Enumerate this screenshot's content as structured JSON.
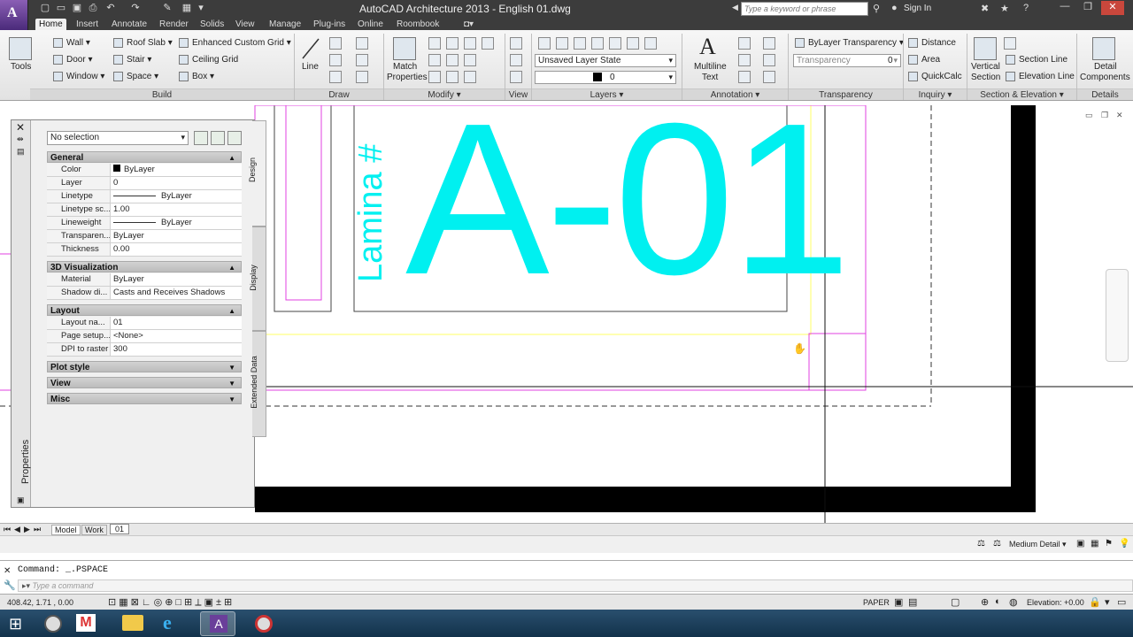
{
  "app": {
    "title": "AutoCAD Architecture 2013 - English    01.dwg",
    "app_button_letter": "A",
    "search_placeholder": "Type a keyword or phrase",
    "signin": "Sign In"
  },
  "tabs": [
    "Home",
    "Insert",
    "Annotate",
    "Render",
    "Solids",
    "View",
    "Manage",
    "Plug-ins",
    "Online",
    "Roombook"
  ],
  "ribbon": {
    "tools": "Tools",
    "build": {
      "wall": "Wall",
      "door": "Door",
      "window": "Window",
      "roof_slab": "Roof Slab",
      "stair": "Stair",
      "space": "Space",
      "enhanced_grid": "Enhanced Custom Grid",
      "ceiling_grid": "Ceiling Grid",
      "box": "Box"
    },
    "line": "Line",
    "match_properties": [
      "Match",
      "Properties"
    ],
    "layer_state": "Unsaved Layer State",
    "layer_value": "0",
    "multiline_text": [
      "Multiline",
      "Text"
    ],
    "bylayer_transparency": "ByLayer Transparency",
    "transparency_label": "Transparency",
    "transparency_value": "0",
    "inquiry": {
      "distance": "Distance",
      "area": "Area",
      "quickcalc": "QuickCalc"
    },
    "vertical_section": [
      "Vertical",
      "Section"
    ],
    "section_line": "Section Line",
    "elevation_line": "Elevation Line",
    "detail_components": [
      "Detail",
      "Components"
    ],
    "panels": {
      "build": "Build",
      "draw": "Draw",
      "modify": "Modify ▾",
      "view": "View",
      "layers": "Layers ▾",
      "annotation": "Annotation ▾",
      "transparency": "Transparency",
      "inquiry": "Inquiry ▾",
      "section_elevation": "Section & Elevation ▾",
      "details": "Details"
    }
  },
  "drawing": {
    "sheet_number": "A-01",
    "sheet_label": "Lamina #"
  },
  "properties": {
    "title": "Properties",
    "selection": "No selection",
    "tabs": [
      "Design",
      "Display",
      "Extended Data"
    ],
    "general": {
      "title": "General",
      "rows": [
        {
          "k": "Color",
          "v": "ByLayer"
        },
        {
          "k": "Layer",
          "v": "0"
        },
        {
          "k": "Linetype",
          "v": "ByLayer"
        },
        {
          "k": "Linetype sc...",
          "v": "1.00"
        },
        {
          "k": "Lineweight",
          "v": "ByLayer"
        },
        {
          "k": "Transparen...",
          "v": "ByLayer"
        },
        {
          "k": "Thickness",
          "v": "0.00"
        }
      ]
    },
    "viz": {
      "title": "3D Visualization",
      "rows": [
        {
          "k": "Material",
          "v": "ByLayer"
        },
        {
          "k": "Shadow di...",
          "v": "Casts and Receives Shadows"
        }
      ]
    },
    "layout": {
      "title": "Layout",
      "rows": [
        {
          "k": "Layout na...",
          "v": "01"
        },
        {
          "k": "Page setup...",
          "v": "<None>"
        },
        {
          "k": "DPI to raster",
          "v": "300"
        }
      ]
    },
    "collapsed": [
      "Plot style",
      "View",
      "Misc"
    ]
  },
  "layout_tabs": [
    "Model",
    "Work",
    "01"
  ],
  "detail_level": "Medium Detail",
  "command": {
    "history": "Command:  _.PSPACE",
    "placeholder": "Type a command"
  },
  "status": {
    "coords": "408.42, 1.71 , 0.00",
    "paper": "PAPER",
    "elevation": "Elevation:  +0.00"
  },
  "colors": {
    "accent": "#00f0f0",
    "magenta": "#e040e0",
    "yellow": "#ffff66"
  }
}
